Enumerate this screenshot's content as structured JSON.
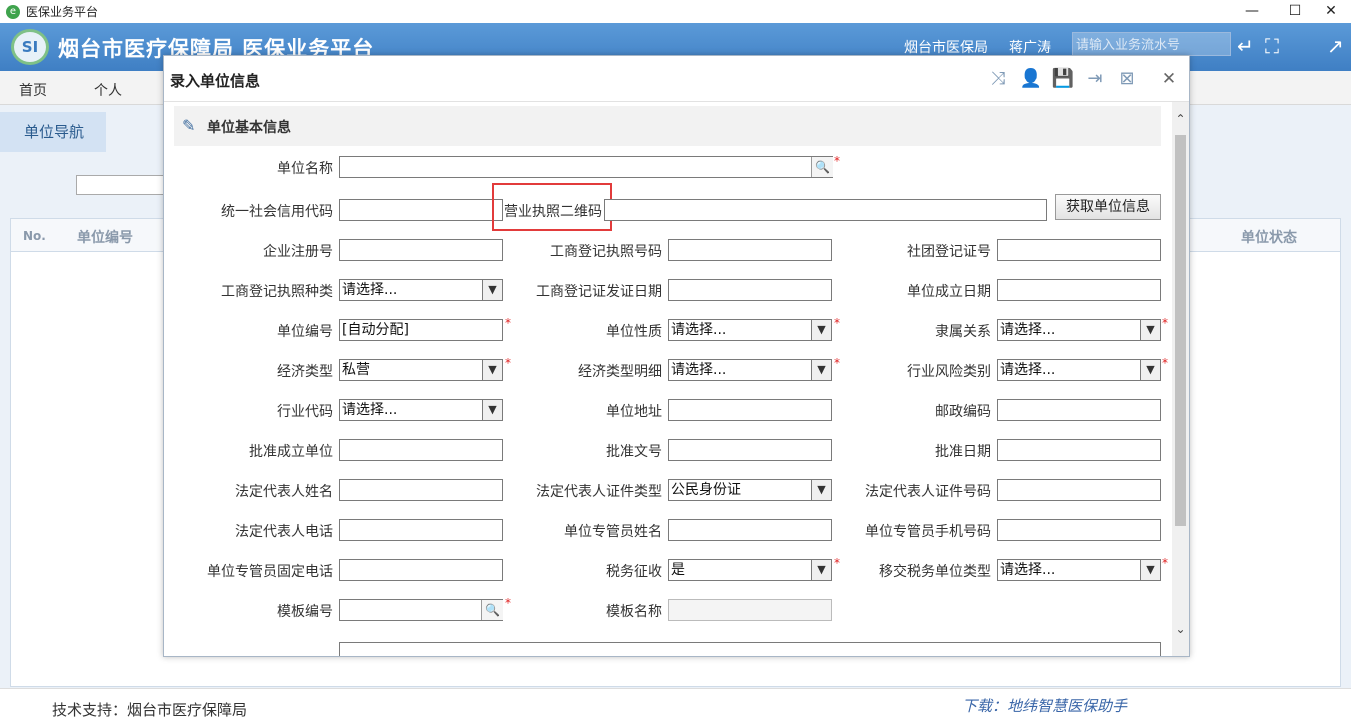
{
  "window": {
    "title": "医保业务平台",
    "minimize": "—",
    "maximize": "☐",
    "close": "✕"
  },
  "header": {
    "logo": "SI",
    "title": "烟台市医疗保障局  医保业务平台",
    "org": "烟台市医保局",
    "user": "蒋广涛",
    "search_placeholder": "请输入业务流水号"
  },
  "nav": {
    "tabs": [
      "首页",
      "个人"
    ]
  },
  "side": {
    "nav_button": "单位导航"
  },
  "grid": {
    "headers": [
      "No.",
      "单位编号",
      "单位状态"
    ]
  },
  "footer": {
    "support": "技术支持：烟台市医疗保障局",
    "download": "下载：地纬智慧医保助手"
  },
  "dialog": {
    "title": "录入单位信息",
    "section_title": "单位基本信息",
    "get_info_button": "获取单位信息",
    "fields": {
      "unit_name": {
        "label": "单位名称",
        "value": ""
      },
      "credit_code": {
        "label": "统一社会信用代码",
        "value": ""
      },
      "qr_code": {
        "label": "营业执照二维码",
        "value": ""
      },
      "enterprise_reg_no": {
        "label": "企业注册号",
        "value": ""
      },
      "biz_license_no": {
        "label": "工商登记执照号码",
        "value": ""
      },
      "social_org_no": {
        "label": "社团登记证号",
        "value": ""
      },
      "biz_license_type": {
        "label": "工商登记执照种类",
        "value": "请选择..."
      },
      "biz_issue_date": {
        "label": "工商登记证发证日期",
        "value": ""
      },
      "founded_date": {
        "label": "单位成立日期",
        "value": ""
      },
      "unit_code": {
        "label": "单位编号",
        "value": "[自动分配]"
      },
      "unit_nature": {
        "label": "单位性质",
        "value": "请选择..."
      },
      "affiliation": {
        "label": "隶属关系",
        "value": "请选择..."
      },
      "economic_type": {
        "label": "经济类型",
        "value": "私营"
      },
      "economic_detail": {
        "label": "经济类型明细",
        "value": "请选择..."
      },
      "industry_risk": {
        "label": "行业风险类别",
        "value": "请选择..."
      },
      "industry_code": {
        "label": "行业代码",
        "value": "请选择..."
      },
      "unit_address": {
        "label": "单位地址",
        "value": ""
      },
      "postal_code": {
        "label": "邮政编码",
        "value": ""
      },
      "approving_unit": {
        "label": "批准成立单位",
        "value": ""
      },
      "approval_doc_no": {
        "label": "批准文号",
        "value": ""
      },
      "approval_date": {
        "label": "批准日期",
        "value": ""
      },
      "legal_rep_name": {
        "label": "法定代表人姓名",
        "value": ""
      },
      "legal_rep_id_type": {
        "label": "法定代表人证件类型",
        "value": "公民身份证"
      },
      "legal_rep_id_no": {
        "label": "法定代表人证件号码",
        "value": ""
      },
      "legal_rep_phone": {
        "label": "法定代表人电话",
        "value": ""
      },
      "admin_name": {
        "label": "单位专管员姓名",
        "value": ""
      },
      "admin_mobile": {
        "label": "单位专管员手机号码",
        "value": ""
      },
      "admin_tel": {
        "label": "单位专管员固定电话",
        "value": ""
      },
      "tax_collect": {
        "label": "税务征收",
        "value": "是"
      },
      "tax_unit_type": {
        "label": "移交税务单位类型",
        "value": "请选择..."
      },
      "template_no": {
        "label": "模板编号",
        "value": ""
      },
      "template_name": {
        "label": "模板名称",
        "value": ""
      }
    }
  }
}
